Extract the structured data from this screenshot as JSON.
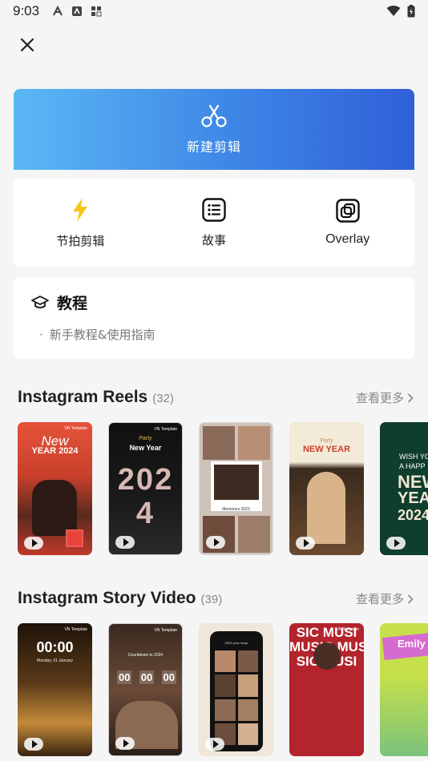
{
  "status_bar": {
    "time": "9:03"
  },
  "hero": {
    "label": "新建剪辑"
  },
  "quick_actions": [
    {
      "label": "节拍剪辑",
      "icon": "lightning-icon"
    },
    {
      "label": "故事",
      "icon": "list-icon"
    },
    {
      "label": "Overlay",
      "icon": "overlay-icon"
    }
  ],
  "tutorial": {
    "title": "教程",
    "link": "新手教程&使用指南"
  },
  "sections": [
    {
      "title": "Instagram Reels",
      "count": "(32)",
      "more": "查看更多",
      "cards": [
        {
          "line1": "New",
          "line2": "YEAR 2024",
          "tag": "VN Template"
        },
        {
          "line1": "Party",
          "line2": "New Year",
          "line3": "2024",
          "tag": "VN Template"
        },
        {
          "caption": "Memories 2023"
        },
        {
          "line1": "Party",
          "line2": "NEW YEAR"
        },
        {
          "line1": "WISH YO",
          "line2": "A HAPP",
          "line3": "NEW",
          "line4": "YEAR",
          "line5": "2024"
        }
      ]
    },
    {
      "title": "Instagram Story Video",
      "count": "(39)",
      "more": "查看更多",
      "cards": [
        {
          "line1": "00:00",
          "line2": "Monday, 01 January",
          "tag": "VN Template"
        },
        {
          "line1": "Countdown to 2024",
          "d1": "00",
          "d2": "00",
          "d3": "00",
          "tag": "VN Template"
        },
        {
          "line1": "2023 year recap"
        },
        {
          "line1": "SIC MUSI",
          "line2": "MUSIC MUS",
          "line3": "SIC MUSI",
          "tag": "VN Template"
        },
        {
          "line1": "Emily"
        }
      ]
    }
  ]
}
